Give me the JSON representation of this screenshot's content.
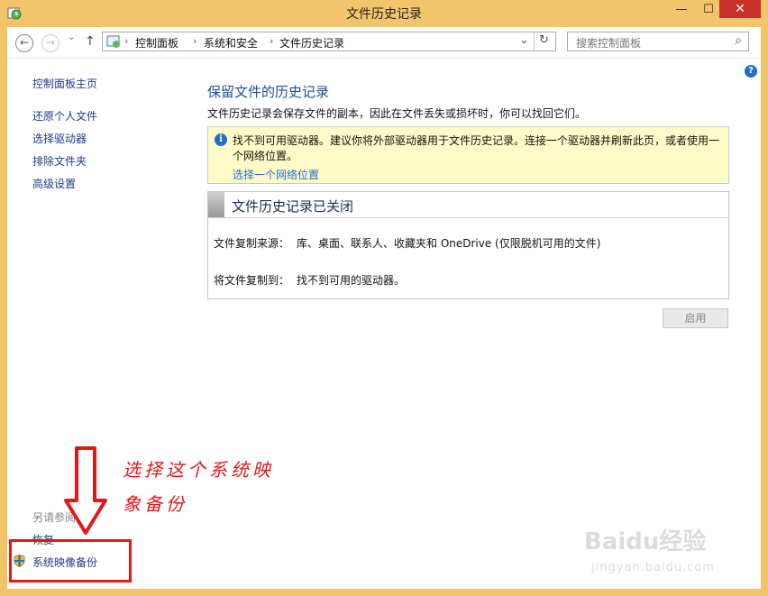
{
  "window": {
    "title": "文件历史记录",
    "minimize": "—",
    "maximize": "☐",
    "close": "✕"
  },
  "address_bar": {
    "back": "←",
    "forward": "→",
    "up": "↑",
    "crumbs": [
      "控制面板",
      "系统和安全",
      "文件历史记录"
    ],
    "crumb_sep": "›",
    "dropdown": "⌄",
    "refresh": "↻",
    "search_placeholder": "搜索控制面板",
    "search_icon": "⌕"
  },
  "sidebar": {
    "home": "控制面板主页",
    "items": [
      "还原个人文件",
      "选择驱动器",
      "排除文件夹",
      "高级设置"
    ],
    "see_also_label": "另请参阅",
    "see_also": [
      "恢复",
      "系统映像备份"
    ]
  },
  "main": {
    "heading": "保留文件的历史记录",
    "intro": "文件历史记录会保存文件的副本，因此在文件丢失或损坏时，你可以找回它们。",
    "info": {
      "icon": "i",
      "message": "找不到可用驱动器。建议你将外部驱动器用于文件历史记录。连接一个驱动器并刷新此页，或者使用一个网络位置。",
      "link": "选择一个网络位置"
    },
    "status": {
      "title": "文件历史记录已关闭",
      "source_label": "文件复制来源：",
      "source_value": "库、桌面、联系人、收藏夹和 OneDrive (仅限脱机可用的文件)",
      "dest_label": "将文件复制到：",
      "dest_value": "找不到可用的驱动器。"
    },
    "enable_button": "启用",
    "help": "?"
  },
  "annotation": {
    "line1": "选择这个系统映",
    "line2": "象备份"
  },
  "watermark": {
    "brand": "Baidu经验",
    "url": "jingyan.baidu.com"
  }
}
